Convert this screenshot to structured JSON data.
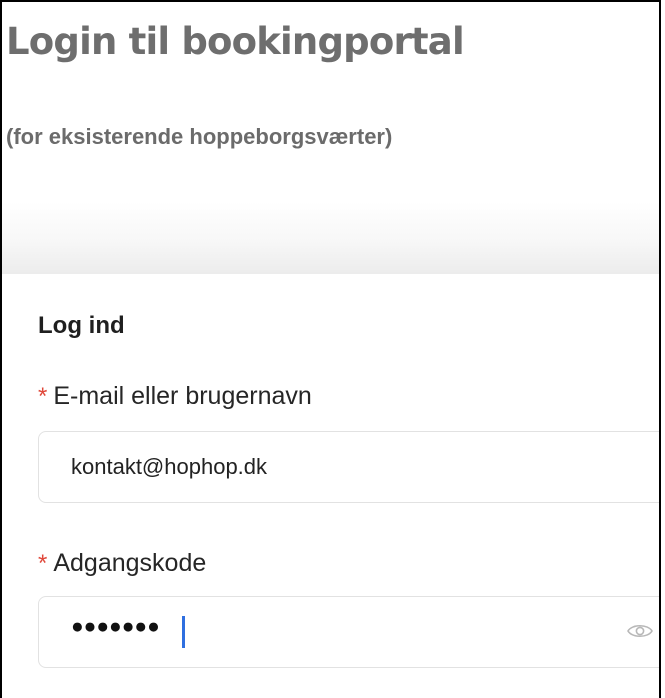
{
  "page": {
    "title": "Login til bookingportal",
    "subtitle": "(for eksisterende hoppeborgsværter)"
  },
  "login_form": {
    "heading": "Log ind",
    "required_marker": "*",
    "email_label": "E-mail eller brugernavn",
    "email_value": "kontakt@hophop.dk",
    "password_label": "Adgangskode",
    "password_masked": "●●●●●●●",
    "password_toggle_icon": "eye-icon"
  },
  "colors": {
    "title_gray": "#6e6e6e",
    "required_red": "#e0483a",
    "caret_blue": "#2f6fe0",
    "field_border": "#e2e2e2"
  }
}
